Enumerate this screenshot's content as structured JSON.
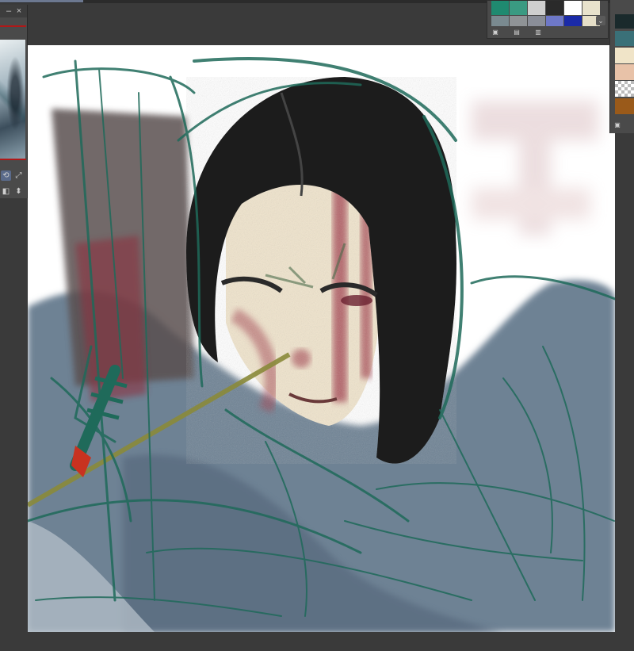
{
  "navigator": {
    "minimize_label": "–",
    "close_label": "×",
    "tools": [
      {
        "icon": "rotate-icon",
        "glyph": "⟲"
      },
      {
        "icon": "fit-icon",
        "glyph": "⤢"
      },
      {
        "icon": "flip-horizontal-icon",
        "glyph": "◧"
      },
      {
        "icon": "flip-vertical-icon",
        "glyph": "⬍"
      }
    ]
  },
  "palette": {
    "swatches_top": [
      "#1f8a70",
      "#3a9a82",
      "#cfcfcf",
      "#2a2a2a",
      "#ffffff",
      "#e8e2cc"
    ],
    "swatches_bottom": [
      "#7a8a90",
      "#8f9396",
      "#8a8e98",
      "#6e78c8",
      "#1a2aa8",
      "#e6dfc8"
    ],
    "tools": [
      {
        "icon": "save-swatch-icon",
        "glyph": "▣"
      },
      {
        "icon": "palette-icon",
        "glyph": "▤"
      },
      {
        "icon": "view-icon",
        "glyph": "▥"
      }
    ],
    "scroll_icon": "⌄"
  },
  "color_strip": {
    "swatches": [
      "#1a2a2c",
      "#3a7078",
      "#f0e4c8",
      "#e8c2a8",
      "checker",
      "#9a5a1a"
    ],
    "tool_icon": "▣"
  },
  "canvas": {
    "colors": {
      "background": "#ffffff",
      "hair": "#1e1e1e",
      "skin": "#f0e4cc",
      "blood": "#a03a48",
      "coat": "#6e8294",
      "sketch_green": "#1f6a5a",
      "gold": "#8a8a3a",
      "tassel": "#c83220"
    }
  }
}
